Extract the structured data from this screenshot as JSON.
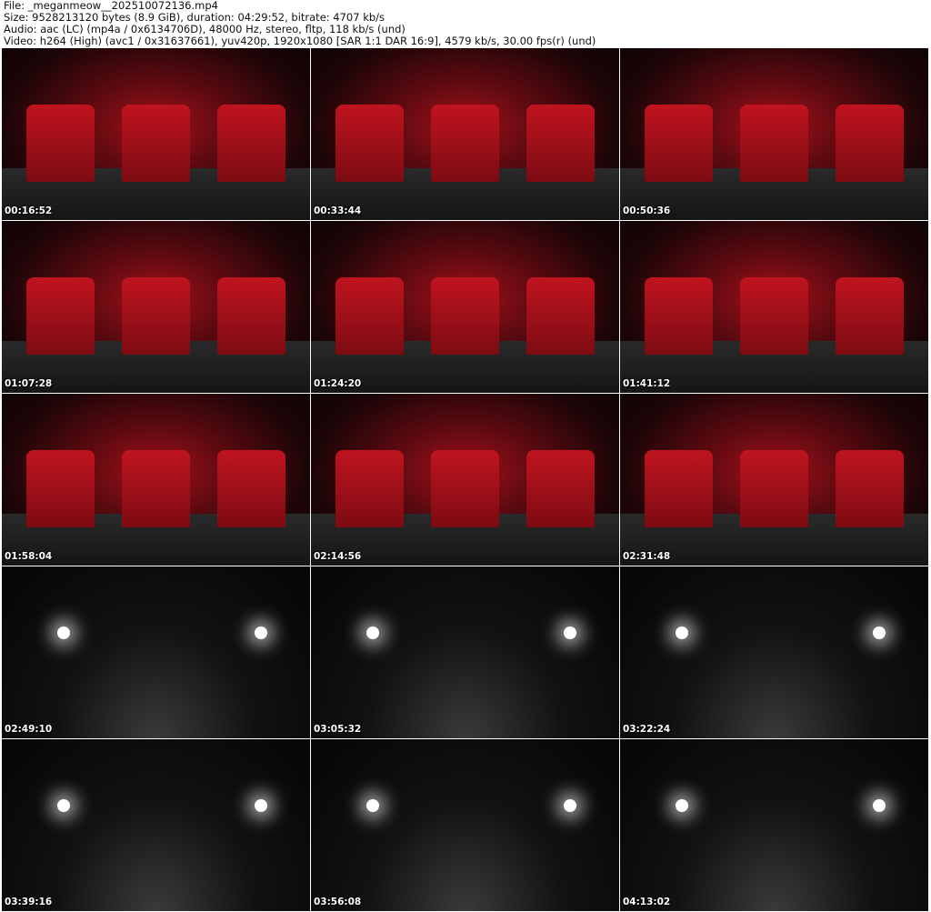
{
  "header": {
    "file": "File: _meganmeow__202510072136.mp4",
    "size": "Size: 9528213120 bytes (8.9 GiB), duration: 04:29:52, bitrate: 4707 kb/s",
    "audio": "Audio: aac (LC) (mp4a / 0x6134706D), 48000 Hz, stereo, fltp, 118 kb/s (und)",
    "video": "Video: h264 (High) (avc1 / 0x31637661), yuv420p, 1920x1080 [SAR 1:1 DAR 16:9], 4579 kb/s, 30.00 fps(r) (und)"
  },
  "thumbnails": [
    {
      "timestamp": "00:16:52",
      "scene": "red"
    },
    {
      "timestamp": "00:33:44",
      "scene": "red"
    },
    {
      "timestamp": "00:50:36",
      "scene": "red"
    },
    {
      "timestamp": "01:07:28",
      "scene": "red"
    },
    {
      "timestamp": "01:24:20",
      "scene": "red"
    },
    {
      "timestamp": "01:41:12",
      "scene": "red"
    },
    {
      "timestamp": "01:58:04",
      "scene": "red"
    },
    {
      "timestamp": "02:14:56",
      "scene": "red"
    },
    {
      "timestamp": "02:31:48",
      "scene": "red"
    },
    {
      "timestamp": "02:49:10",
      "scene": "dark"
    },
    {
      "timestamp": "03:05:32",
      "scene": "dark"
    },
    {
      "timestamp": "03:22:24",
      "scene": "dark"
    },
    {
      "timestamp": "03:39:16",
      "scene": "dark"
    },
    {
      "timestamp": "03:56:08",
      "scene": "dark"
    },
    {
      "timestamp": "04:13:02",
      "scene": "dark"
    }
  ]
}
